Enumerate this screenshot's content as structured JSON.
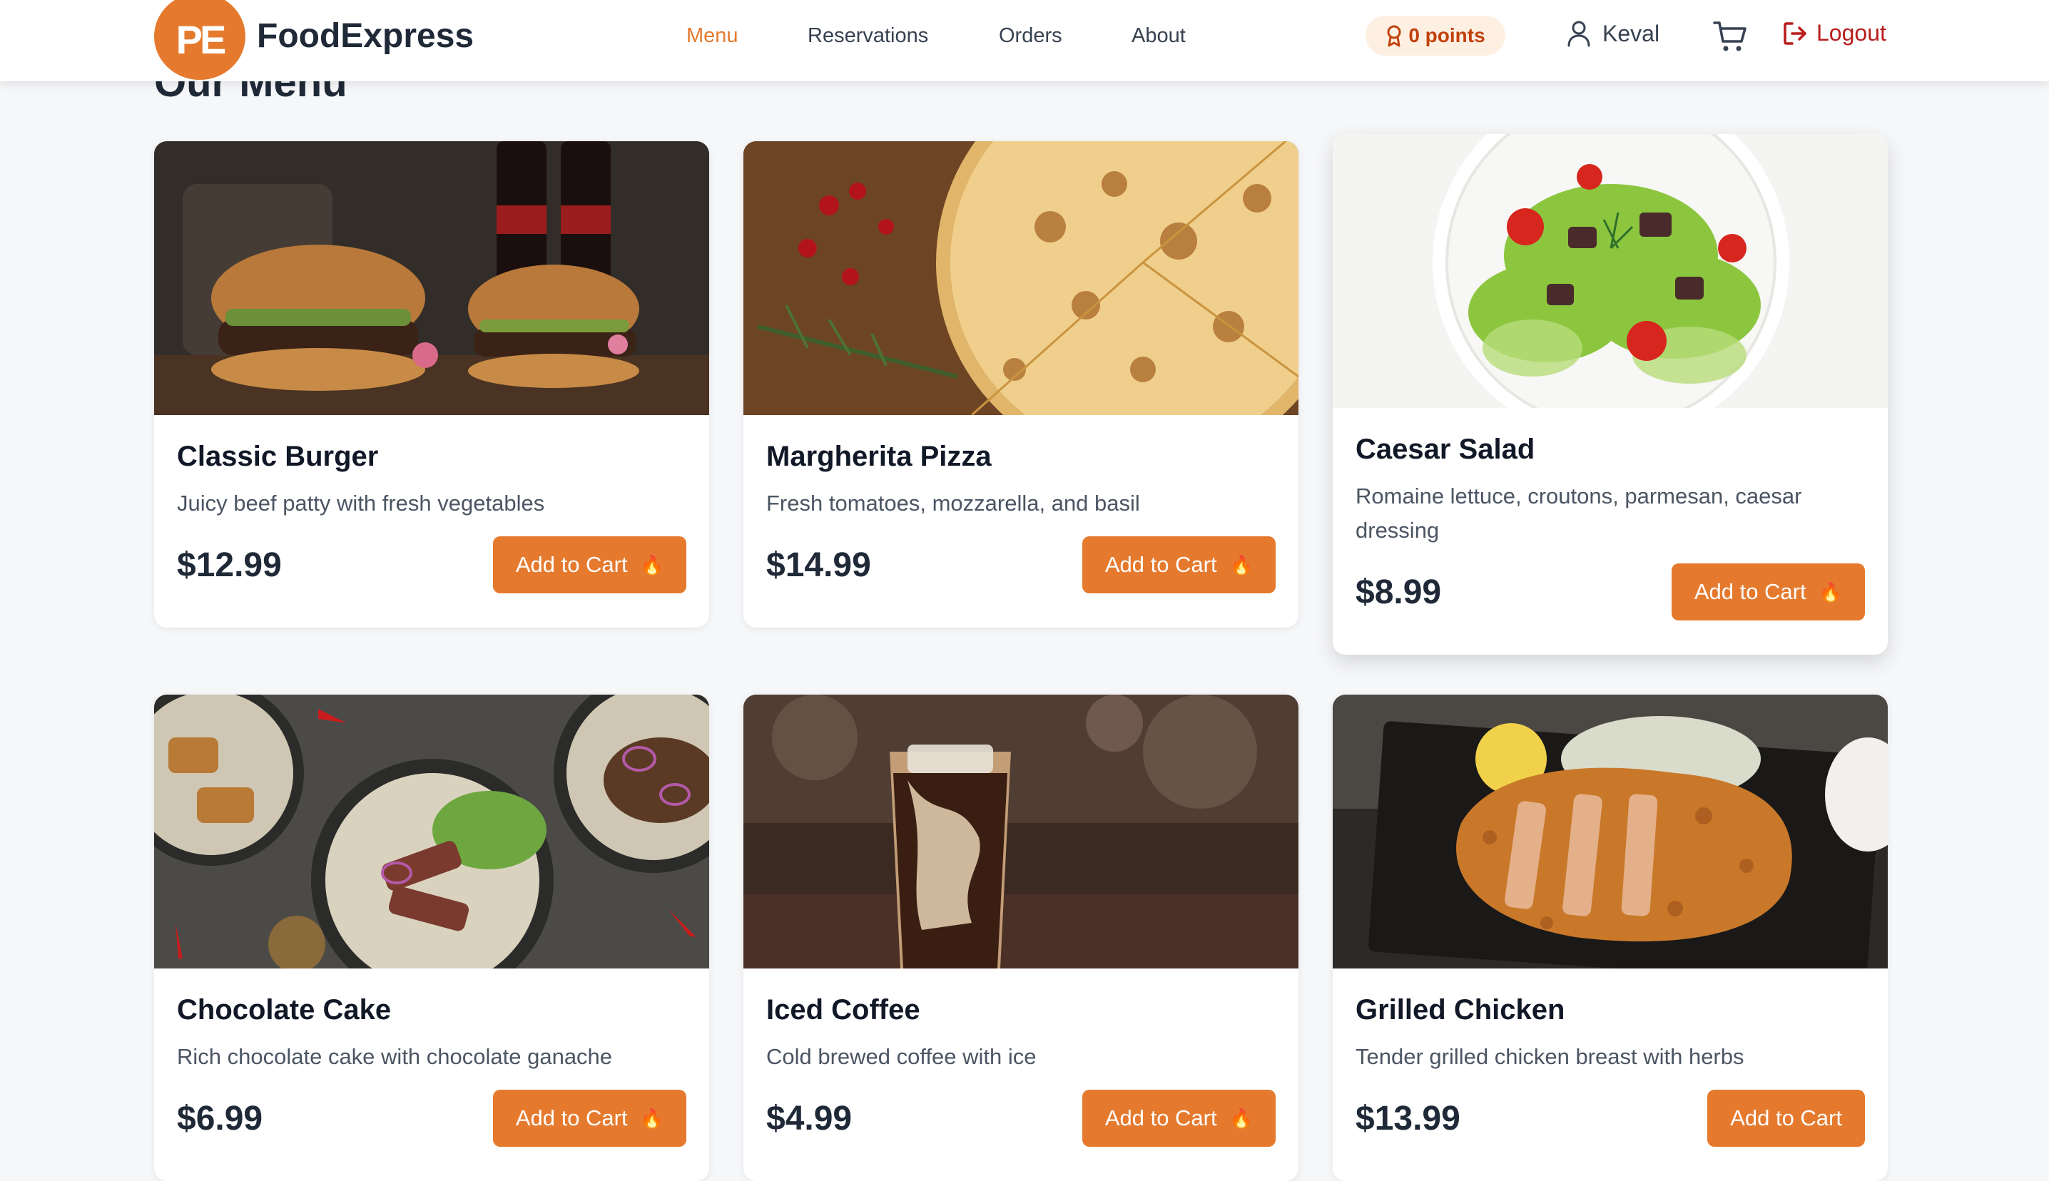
{
  "header": {
    "logo_text": "PE",
    "brand": "FoodExpress",
    "nav": [
      {
        "label": "Menu",
        "active": true
      },
      {
        "label": "Reservations",
        "active": false
      },
      {
        "label": "Orders",
        "active": false
      },
      {
        "label": "About",
        "active": false
      }
    ],
    "points": "0 points",
    "user_name": "Keval",
    "logout_label": "Logout"
  },
  "page": {
    "title": "Our Menu"
  },
  "colors": {
    "accent": "#e57a2e",
    "logout": "#b91c1c",
    "background": "#f6f7f9"
  },
  "menu": [
    {
      "name": "Classic Burger",
      "description": "Juicy beef patty with fresh vegetables",
      "price": "$12.99",
      "button": "Add to Cart",
      "image": "burger-photo",
      "hot_icon": true
    },
    {
      "name": "Margherita Pizza",
      "description": "Fresh tomatoes, mozzarella, and basil",
      "price": "$14.99",
      "button": "Add to Cart",
      "image": "pizza-photo",
      "hot_icon": true
    },
    {
      "name": "Caesar Salad",
      "description": "Romaine lettuce, croutons, parmesan, caesar dressing",
      "price": "$8.99",
      "button": "Add to Cart",
      "image": "salad-photo",
      "hot_icon": true
    },
    {
      "name": "Chocolate Cake",
      "description": "Rich chocolate cake with chocolate ganache",
      "price": "$6.99",
      "button": "Add to Cart",
      "image": "beef-salad-photo",
      "hot_icon": true
    },
    {
      "name": "Iced Coffee",
      "description": "Cold brewed coffee with ice",
      "price": "$4.99",
      "button": "Add to Cart",
      "image": "iced-coffee-photo",
      "hot_icon": true
    },
    {
      "name": "Grilled Chicken",
      "description": "Tender grilled chicken breast with herbs",
      "price": "$13.99",
      "button": "Add to Cart",
      "image": "katsu-photo",
      "hot_icon": false
    }
  ]
}
